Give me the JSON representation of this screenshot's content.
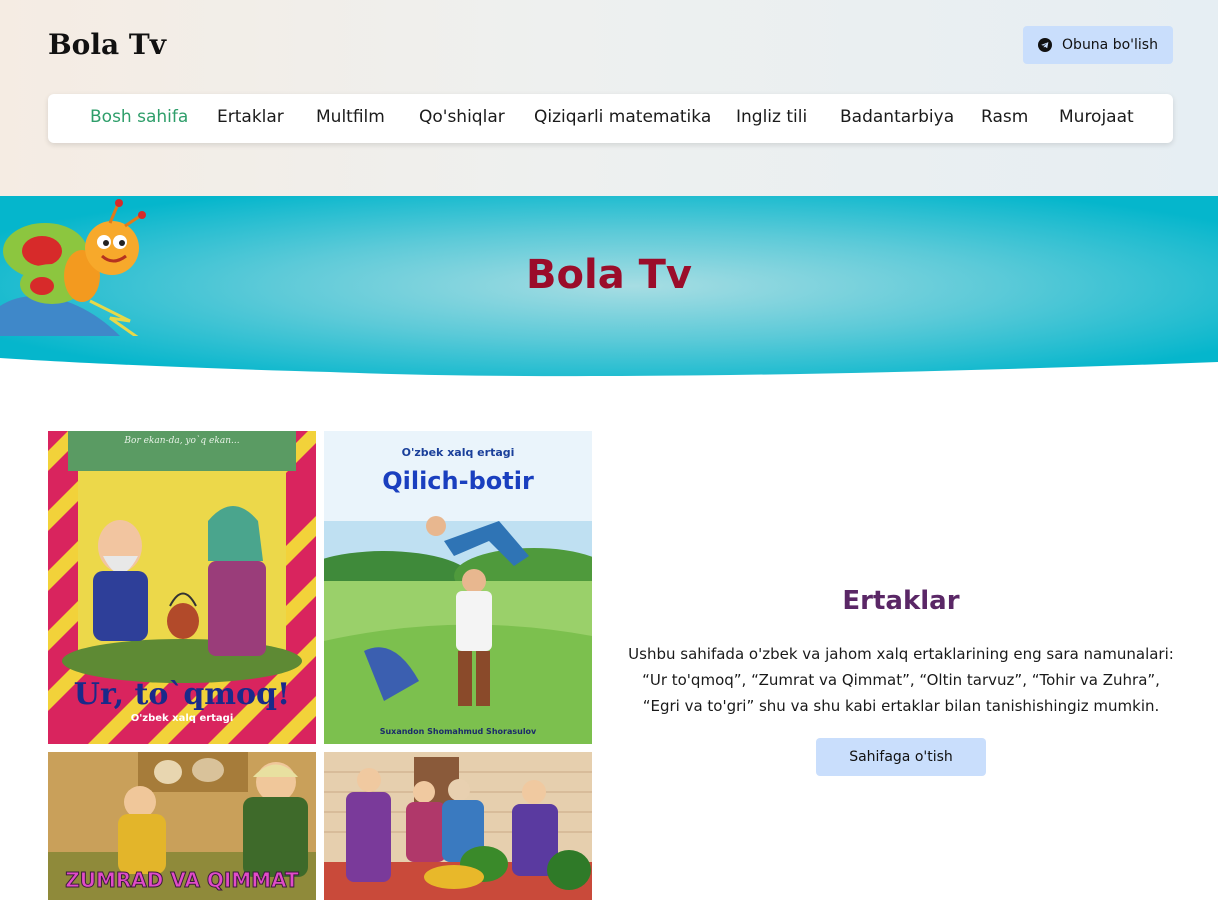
{
  "header": {
    "logo": "Bola Tv",
    "subscribe_label": "Obuna bo'lish"
  },
  "nav": {
    "items": [
      {
        "label": "Bosh sahifa",
        "active": true
      },
      {
        "label": "Ertaklar"
      },
      {
        "label": "Multfilm"
      },
      {
        "label": "Qo'shiqlar"
      },
      {
        "label": "Qiziqarli matematika"
      },
      {
        "label": "Ingliz tili"
      },
      {
        "label": "Badantarbiya"
      },
      {
        "label": "Rasm"
      },
      {
        "label": "Murojaat"
      }
    ]
  },
  "hero": {
    "title": "Bola Tv"
  },
  "thumbnails": [
    {
      "caption": "Ur, to`qmoq!",
      "subcaption": "O'zbek xalq ertagi",
      "banner": "Bor ekan-da, yo`q ekan..."
    },
    {
      "caption": "Qilich-botir",
      "subcaption": "O'zbek xalq ertagi",
      "credit": "Suxandon Shomahmud Shorasulov"
    },
    {
      "caption": "ZUMRAD VA QIMMAT"
    },
    {
      "caption": ""
    }
  ],
  "section": {
    "title": "Ertaklar",
    "description": "Ushbu sahifada o'zbek va jahom xalq ertaklarining eng sara namunalari: “Ur to'qmoq”, “Zumrat va Qimmat”, “Oltin tarvuz”, “Tohir va Zuhra”, “Egri va to'gri” shu va shu kabi ertaklar bilan tanishishingiz mumkin.",
    "button_label": "Sahifaga o'tish"
  },
  "colors": {
    "accent_green": "#2e9e6a",
    "hero_title": "#9b0c2a",
    "section_title": "#5a2766",
    "button_bg": "#c9defc",
    "hero_band": "#2cc0d2"
  }
}
